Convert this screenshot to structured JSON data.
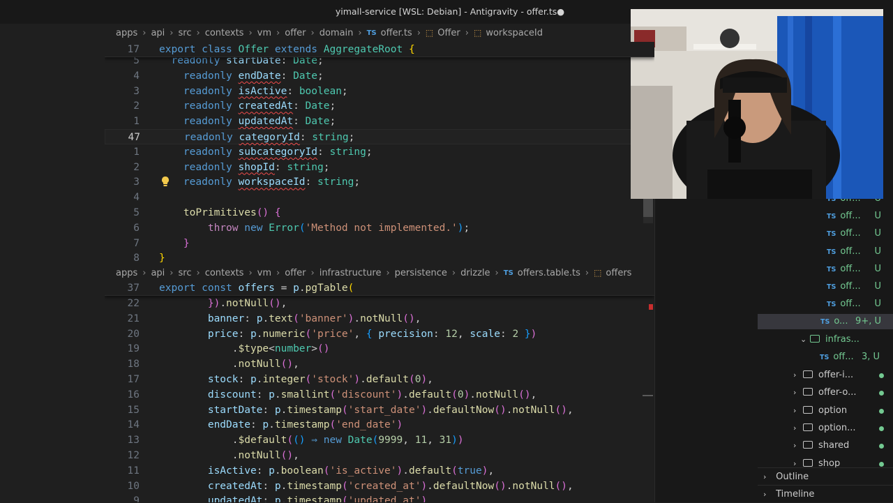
{
  "window": {
    "title": "yimall-service [WSL: Debian] - Antigravity - offer.ts●"
  },
  "top_breadcrumb": {
    "crumbs": [
      "apps",
      "api",
      "src",
      "contexts",
      "vm",
      "offer",
      "domain"
    ],
    "file": "offer.ts",
    "file_icon": "TS",
    "symbols": [
      "Offer",
      "workspaceId"
    ]
  },
  "top_editor": {
    "sticky": {
      "ln": "17",
      "tokens": [
        [
          "kw",
          "export "
        ],
        [
          "kw",
          "class "
        ],
        [
          "cls",
          "Offer "
        ],
        [
          "kw",
          "extends "
        ],
        [
          "cls",
          "AggregateRoot "
        ],
        [
          "br1",
          "{"
        ]
      ]
    },
    "lines": [
      {
        "ln": "5",
        "tokens": [
          [
            "",
            "  "
          ],
          [
            "kw",
            "readonly "
          ],
          [
            "prop",
            "startDate"
          ],
          [
            "",
            ": "
          ],
          [
            "typ",
            "Date"
          ],
          [
            "",
            ";"
          ]
        ]
      },
      {
        "ln": "4",
        "tokens": [
          [
            "",
            "    "
          ],
          [
            "kw",
            "readonly "
          ],
          [
            "prop wavy",
            "endDate"
          ],
          [
            "",
            ": "
          ],
          [
            "typ",
            "Date"
          ],
          [
            "",
            ";"
          ]
        ]
      },
      {
        "ln": "3",
        "tokens": [
          [
            "",
            "    "
          ],
          [
            "kw",
            "readonly "
          ],
          [
            "prop wavy",
            "isActive"
          ],
          [
            "",
            ": "
          ],
          [
            "typ",
            "boolean"
          ],
          [
            "",
            ";"
          ]
        ]
      },
      {
        "ln": "2",
        "tokens": [
          [
            "",
            "    "
          ],
          [
            "kw",
            "readonly "
          ],
          [
            "prop wavy",
            "createdAt"
          ],
          [
            "",
            ": "
          ],
          [
            "typ",
            "Date"
          ],
          [
            "",
            ";"
          ]
        ]
      },
      {
        "ln": "1",
        "tokens": [
          [
            "",
            "    "
          ],
          [
            "kw",
            "readonly "
          ],
          [
            "prop wavy",
            "updatedAt"
          ],
          [
            "",
            ": "
          ],
          [
            "typ",
            "Date"
          ],
          [
            "",
            ";"
          ]
        ]
      },
      {
        "ln": "47",
        "cur": true,
        "tokens": [
          [
            "",
            "    "
          ],
          [
            "kw",
            "readonly "
          ],
          [
            "prop wavy",
            "categoryId"
          ],
          [
            "",
            ": "
          ],
          [
            "typ",
            "string"
          ],
          [
            "",
            ";"
          ]
        ]
      },
      {
        "ln": "1",
        "tokens": [
          [
            "",
            "    "
          ],
          [
            "kw",
            "readonly "
          ],
          [
            "prop wavy",
            "subcategoryId"
          ],
          [
            "",
            ": "
          ],
          [
            "typ",
            "string"
          ],
          [
            "",
            ";"
          ]
        ]
      },
      {
        "ln": "2",
        "tokens": [
          [
            "",
            "    "
          ],
          [
            "kw",
            "readonly "
          ],
          [
            "prop wavy",
            "shopId"
          ],
          [
            "",
            ": "
          ],
          [
            "typ",
            "string"
          ],
          [
            "",
            ";"
          ]
        ]
      },
      {
        "ln": "3",
        "bulb": true,
        "tokens": [
          [
            "",
            "    "
          ],
          [
            "kw",
            "readonly "
          ],
          [
            "prop wavy",
            "workspaceId"
          ],
          [
            "",
            ": "
          ],
          [
            "typ",
            "string"
          ],
          [
            "",
            ";"
          ]
        ]
      },
      {
        "ln": "4",
        "tokens": []
      },
      {
        "ln": "5",
        "tokens": [
          [
            "",
            "    "
          ],
          [
            "fn",
            "toPrimitives"
          ],
          [
            "br2",
            "()"
          ],
          [
            "",
            ""
          ],
          [
            "br2",
            " {"
          ]
        ]
      },
      {
        "ln": "6",
        "tokens": [
          [
            "",
            "        "
          ],
          [
            "kc",
            "throw "
          ],
          [
            "kw",
            "new "
          ],
          [
            "cls",
            "Error"
          ],
          [
            "br3",
            "("
          ],
          [
            "str",
            "'Method not implemented.'"
          ],
          [
            "br3",
            ")"
          ],
          [
            "",
            ";"
          ]
        ]
      },
      {
        "ln": "7",
        "tokens": [
          [
            "",
            "    "
          ],
          [
            "br2",
            "}"
          ]
        ]
      },
      {
        "ln": "8",
        "tokens": [
          [
            "br1",
            "}"
          ]
        ]
      }
    ]
  },
  "bottom_breadcrumb": {
    "crumbs": [
      "apps",
      "api",
      "src",
      "contexts",
      "vm",
      "offer",
      "infrastructure",
      "persistence",
      "drizzle"
    ],
    "file": "offers.table.ts",
    "file_icon": "TS",
    "symbols": [
      "offers"
    ]
  },
  "bottom_editor": {
    "sticky": {
      "ln": "37",
      "tokens": [
        [
          "kw",
          "export "
        ],
        [
          "kw",
          "const "
        ],
        [
          "prop",
          "offers "
        ],
        [
          "",
          "= "
        ],
        [
          "prop",
          "p"
        ],
        [
          "",
          "."
        ],
        [
          "fn",
          "pgTable"
        ],
        [
          "br1",
          "("
        ]
      ]
    },
    "lines": [
      {
        "ln": "22",
        "tokens": [
          [
            "",
            "        "
          ],
          [
            "br2",
            "})"
          ],
          [
            "",
            "."
          ],
          [
            "fn",
            "notNull"
          ],
          [
            "br2",
            "()"
          ],
          [
            "",
            ","
          ]
        ]
      },
      {
        "ln": "21",
        "tokens": [
          [
            "",
            "        "
          ],
          [
            "prop",
            "banner"
          ],
          [
            "",
            ": "
          ],
          [
            "prop",
            "p"
          ],
          [
            "",
            "."
          ],
          [
            "fn",
            "text"
          ],
          [
            "br2",
            "("
          ],
          [
            "str",
            "'banner'"
          ],
          [
            "br2",
            ")"
          ],
          [
            "",
            "."
          ],
          [
            "fn",
            "notNull"
          ],
          [
            "br2",
            "()"
          ],
          [
            "",
            ","
          ]
        ]
      },
      {
        "ln": "20",
        "tokens": [
          [
            "",
            "        "
          ],
          [
            "prop",
            "price"
          ],
          [
            "",
            ": "
          ],
          [
            "prop",
            "p"
          ],
          [
            "",
            "."
          ],
          [
            "fn",
            "numeric"
          ],
          [
            "br2",
            "("
          ],
          [
            "str",
            "'price'"
          ],
          [
            "",
            ", "
          ],
          [
            "br3",
            "{ "
          ],
          [
            "prop",
            "precision"
          ],
          [
            "",
            ": "
          ],
          [
            "num",
            "12"
          ],
          [
            "",
            ", "
          ],
          [
            "prop",
            "scale"
          ],
          [
            "",
            ": "
          ],
          [
            "num",
            "2"
          ],
          [
            "br3",
            " }"
          ],
          [
            "br2",
            ")"
          ]
        ]
      },
      {
        "ln": "19",
        "tokens": [
          [
            "",
            "            ."
          ],
          [
            "fn",
            "$type"
          ],
          [
            "",
            "<"
          ],
          [
            "typ",
            "number"
          ],
          [
            "",
            ">"
          ],
          [
            "br2",
            "()"
          ]
        ]
      },
      {
        "ln": "18",
        "tokens": [
          [
            "",
            "            ."
          ],
          [
            "fn",
            "notNull"
          ],
          [
            "br2",
            "()"
          ],
          [
            "",
            ","
          ]
        ]
      },
      {
        "ln": "17",
        "tokens": [
          [
            "",
            "        "
          ],
          [
            "prop",
            "stock"
          ],
          [
            "",
            ": "
          ],
          [
            "prop",
            "p"
          ],
          [
            "",
            "."
          ],
          [
            "fn",
            "integer"
          ],
          [
            "br2",
            "("
          ],
          [
            "str",
            "'stock'"
          ],
          [
            "br2",
            ")"
          ],
          [
            "",
            "."
          ],
          [
            "fn",
            "default"
          ],
          [
            "br2",
            "("
          ],
          [
            "num",
            "0"
          ],
          [
            "br2",
            ")"
          ],
          [
            "",
            ","
          ]
        ]
      },
      {
        "ln": "16",
        "tokens": [
          [
            "",
            "        "
          ],
          [
            "prop",
            "discount"
          ],
          [
            "",
            ": "
          ],
          [
            "prop",
            "p"
          ],
          [
            "",
            "."
          ],
          [
            "fn",
            "smallint"
          ],
          [
            "br2",
            "("
          ],
          [
            "str",
            "'discount'"
          ],
          [
            "br2",
            ")"
          ],
          [
            "",
            "."
          ],
          [
            "fn",
            "default"
          ],
          [
            "br2",
            "("
          ],
          [
            "num",
            "0"
          ],
          [
            "br2",
            ")"
          ],
          [
            "",
            "."
          ],
          [
            "fn",
            "notNull"
          ],
          [
            "br2",
            "()"
          ],
          [
            "",
            ","
          ]
        ]
      },
      {
        "ln": "15",
        "tokens": [
          [
            "",
            "        "
          ],
          [
            "prop",
            "startDate"
          ],
          [
            "",
            ": "
          ],
          [
            "prop",
            "p"
          ],
          [
            "",
            "."
          ],
          [
            "fn",
            "timestamp"
          ],
          [
            "br2",
            "("
          ],
          [
            "str",
            "'start_date'"
          ],
          [
            "br2",
            ")"
          ],
          [
            "",
            "."
          ],
          [
            "fn",
            "defaultNow"
          ],
          [
            "br2",
            "()"
          ],
          [
            "",
            "."
          ],
          [
            "fn",
            "notNull"
          ],
          [
            "br2",
            "()"
          ],
          [
            "",
            ","
          ]
        ]
      },
      {
        "ln": "14",
        "tokens": [
          [
            "",
            "        "
          ],
          [
            "prop",
            "endDate"
          ],
          [
            "",
            ": "
          ],
          [
            "prop",
            "p"
          ],
          [
            "",
            "."
          ],
          [
            "fn",
            "timestamp"
          ],
          [
            "br2",
            "("
          ],
          [
            "str",
            "'end_date'"
          ],
          [
            "br2",
            ")"
          ]
        ]
      },
      {
        "ln": "13",
        "tokens": [
          [
            "",
            "            ."
          ],
          [
            "fn",
            "$default"
          ],
          [
            "br2",
            "("
          ],
          [
            "br3",
            "()"
          ],
          [
            "kw",
            " ⇒ "
          ],
          [
            "kw",
            "new "
          ],
          [
            "cls",
            "Date"
          ],
          [
            "br3",
            "("
          ],
          [
            "num",
            "9999"
          ],
          [
            "",
            ", "
          ],
          [
            "num",
            "11"
          ],
          [
            "",
            ", "
          ],
          [
            "num",
            "31"
          ],
          [
            "br3",
            ")"
          ],
          [
            "br2",
            ")"
          ]
        ]
      },
      {
        "ln": "12",
        "tokens": [
          [
            "",
            "            ."
          ],
          [
            "fn",
            "notNull"
          ],
          [
            "br2",
            "()"
          ],
          [
            "",
            ","
          ]
        ]
      },
      {
        "ln": "11",
        "tokens": [
          [
            "",
            "        "
          ],
          [
            "prop",
            "isActive"
          ],
          [
            "",
            ": "
          ],
          [
            "prop",
            "p"
          ],
          [
            "",
            "."
          ],
          [
            "fn",
            "boolean"
          ],
          [
            "br2",
            "("
          ],
          [
            "str",
            "'is_active'"
          ],
          [
            "br2",
            ")"
          ],
          [
            "",
            "."
          ],
          [
            "fn",
            "default"
          ],
          [
            "br2",
            "("
          ],
          [
            "kw",
            "true"
          ],
          [
            "br2",
            ")"
          ],
          [
            "",
            ","
          ]
        ]
      },
      {
        "ln": "10",
        "tokens": [
          [
            "",
            "        "
          ],
          [
            "prop",
            "createdAt"
          ],
          [
            "",
            ": "
          ],
          [
            "prop",
            "p"
          ],
          [
            "",
            "."
          ],
          [
            "fn",
            "timestamp"
          ],
          [
            "br2",
            "("
          ],
          [
            "str",
            "'created_at'"
          ],
          [
            "br2",
            ")"
          ],
          [
            "",
            "."
          ],
          [
            "fn",
            "defaultNow"
          ],
          [
            "br2",
            "()"
          ],
          [
            "",
            "."
          ],
          [
            "fn",
            "notNull"
          ],
          [
            "br2",
            "()"
          ],
          [
            "",
            ","
          ]
        ]
      },
      {
        "ln": "9",
        "tokens": [
          [
            "",
            "        "
          ],
          [
            "prop",
            "updatedAt"
          ],
          [
            "",
            ": "
          ],
          [
            "prop",
            "p"
          ],
          [
            "",
            "."
          ],
          [
            "fn",
            "timestamp"
          ],
          [
            "br2",
            "("
          ],
          [
            "str",
            "'updated_at'"
          ],
          [
            "br2",
            ")"
          ]
        ]
      }
    ]
  },
  "explorer": {
    "files": [
      {
        "label": "off...",
        "status": "U"
      },
      {
        "label": "off...",
        "status": "U"
      },
      {
        "label": "off...",
        "status": "U"
      },
      {
        "label": "off...",
        "status": "U"
      },
      {
        "label": "off...",
        "status": "U"
      },
      {
        "label": "off...",
        "status": "U"
      },
      {
        "label": "off...",
        "status": "U"
      }
    ],
    "active_file": {
      "label": "o...",
      "status": "9+, U"
    },
    "infra_folder": {
      "label": "infras...",
      "open": true
    },
    "infra_file": {
      "label": "off...",
      "status": "3, U"
    },
    "folders": [
      {
        "label": "offer-i..."
      },
      {
        "label": "offer-o..."
      },
      {
        "label": "option"
      },
      {
        "label": "option..."
      },
      {
        "label": "shared"
      },
      {
        "label": "shop"
      }
    ],
    "file_icon": "TS"
  },
  "panels": {
    "outline": "Outline",
    "timeline": "Timeline"
  },
  "colors": {
    "keyword": "#569cd6",
    "class": "#4ec9b0",
    "property": "#9cdcfe",
    "function": "#dcdcaa",
    "string": "#ce9178",
    "number": "#b5cea8",
    "untracked": "#73c991"
  }
}
